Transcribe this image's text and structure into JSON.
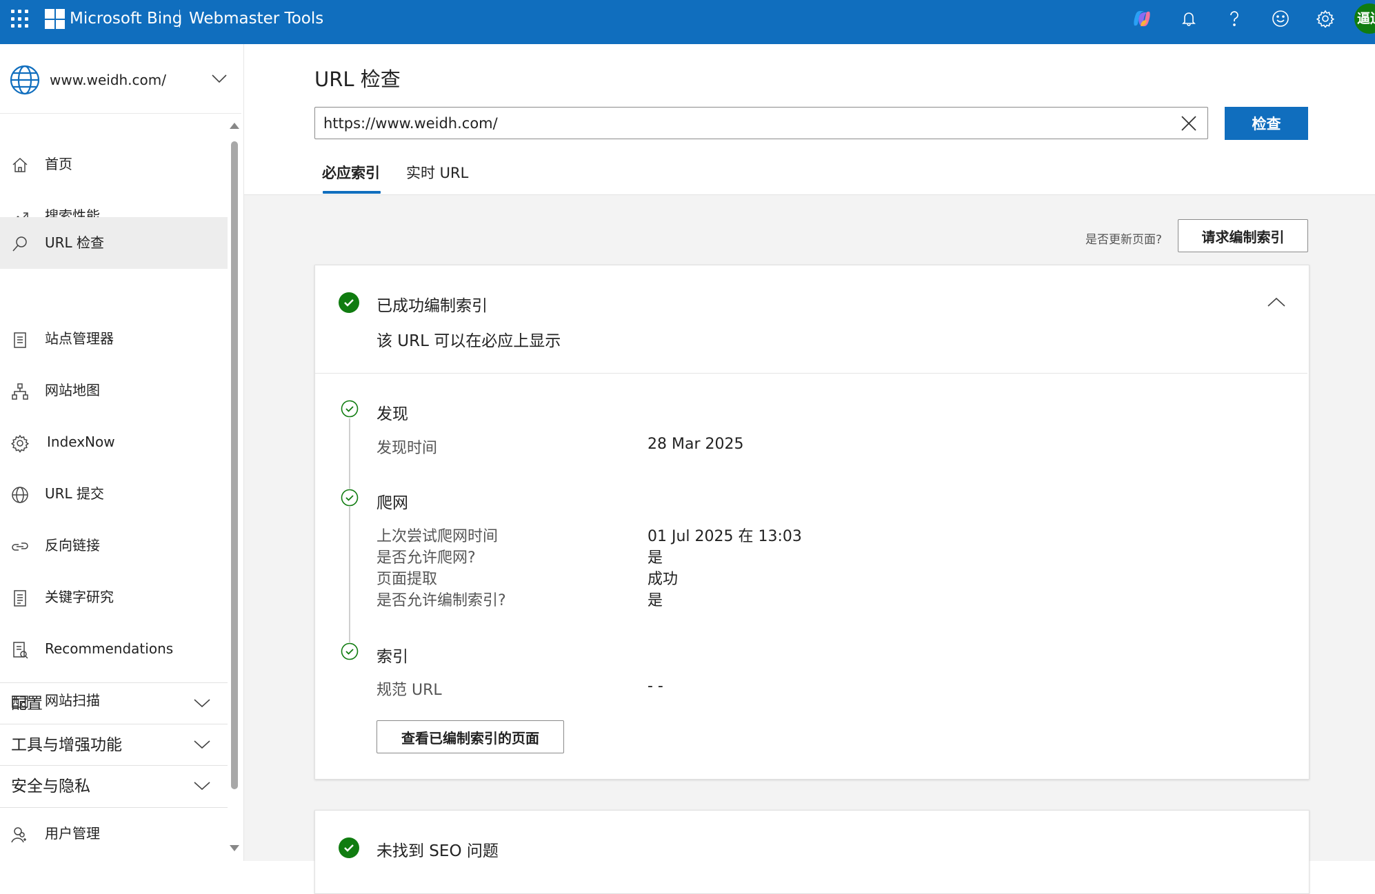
{
  "header": {
    "brand": "Microsoft Bing",
    "product": "Webmaster Tools",
    "avatar_text": "逼迫",
    "icons": [
      "app-launcher-icon",
      "copilot-icon",
      "bell-icon",
      "help-icon",
      "smiley-icon",
      "gear-icon"
    ],
    "accent_color": "#106EBE"
  },
  "sidebar": {
    "site": "www.weidh.com/",
    "items": [
      {
        "label": "首页",
        "icon": "home-icon"
      },
      {
        "label": "搜索性能",
        "icon": "trend-icon"
      },
      {
        "label": "URL 检查",
        "icon": "search-icon",
        "active": true
      },
      {
        "label": "站点管理器",
        "icon": "clipboard-icon"
      },
      {
        "label": "网站地图",
        "icon": "sitemap-icon"
      },
      {
        "label": "IndexNow",
        "icon": "gear-icon"
      },
      {
        "label": "URL 提交",
        "icon": "globe-icon"
      },
      {
        "label": "反向链接",
        "icon": "link-icon"
      },
      {
        "label": "关键字研究",
        "icon": "document-icon"
      },
      {
        "label": "Recommendations",
        "icon": "recommendation-icon"
      },
      {
        "label": "网站扫描",
        "icon": "scan-icon"
      }
    ],
    "groups": [
      {
        "label": "配置"
      },
      {
        "label": "工具与增强功能"
      },
      {
        "label": "安全与隐私"
      }
    ],
    "user_mgmt": {
      "label": "用户管理",
      "icon": "user-icon"
    }
  },
  "main": {
    "title": "URL 检查",
    "url_value": "https://www.weidh.com/",
    "inspect_label": "检查",
    "tabs": [
      {
        "label": "必应索引",
        "active": true
      },
      {
        "label": "实时 URL",
        "active": false
      }
    ],
    "update_question": "是否更新页面?",
    "request_index_label": "请求编制索引",
    "status_card": {
      "title": "已成功编制索引",
      "subtitle": "该 URL 可以在必应上显示"
    },
    "discovery": {
      "title": "发现",
      "rows": [
        {
          "label": "发现时间",
          "value": "28 Mar 2025"
        }
      ]
    },
    "crawl": {
      "title": "爬网",
      "rows": [
        {
          "label": "上次尝试爬网时间",
          "value": "01 Jul 2025 在 13:03"
        },
        {
          "label": "是否允许爬网?",
          "value": "是"
        },
        {
          "label": "页面提取",
          "value": "成功"
        },
        {
          "label": "是否允许编制索引?",
          "value": "是"
        }
      ]
    },
    "index": {
      "title": "索引",
      "rows": [
        {
          "label": "规范 URL",
          "value": "- -"
        }
      ]
    },
    "view_indexed_label": "查看已编制索引的页面",
    "seo_card": {
      "title": "未找到 SEO 问题"
    },
    "success_color": "#107C10"
  }
}
